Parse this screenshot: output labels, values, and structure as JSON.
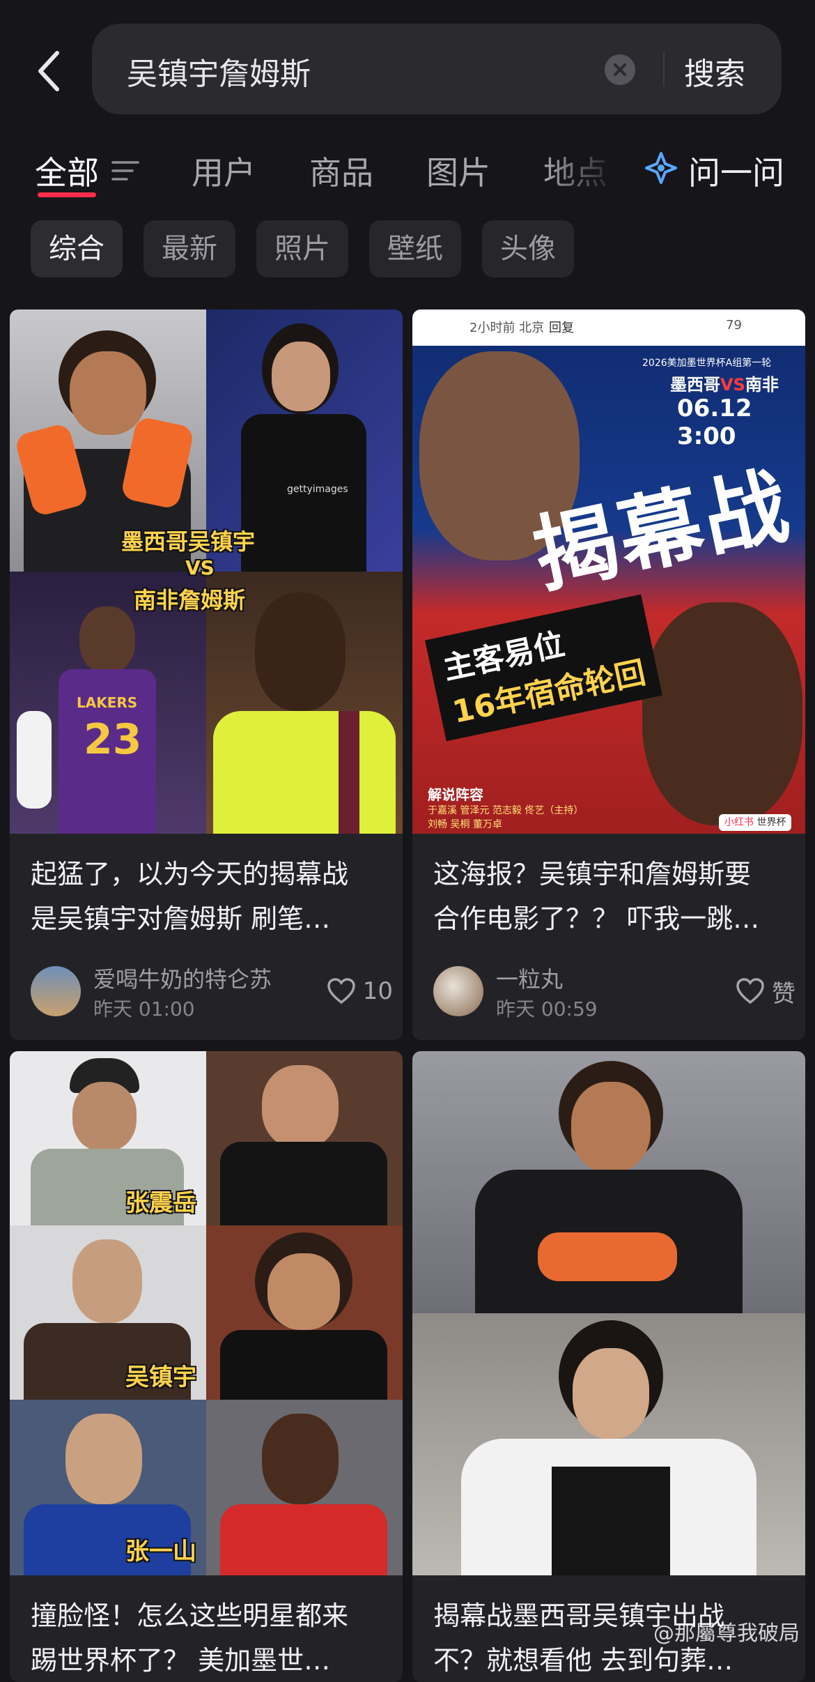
{
  "search": {
    "query": "吴镇宇詹姆斯",
    "button_label": "搜索"
  },
  "tabs": [
    {
      "label": "全部"
    },
    {
      "label": "用户"
    },
    {
      "label": "商品"
    },
    {
      "label": "图片"
    },
    {
      "label": "地点"
    }
  ],
  "ask": {
    "label": "问一问"
  },
  "chips": [
    {
      "label": "综合"
    },
    {
      "label": "最新"
    },
    {
      "label": "照片"
    },
    {
      "label": "壁纸"
    },
    {
      "label": "头像"
    }
  ],
  "cards": [
    {
      "title_line1": "起猛了，以为今天的揭幕战",
      "title_line2": "是吴镇宇对詹姆斯 刷笔…",
      "author": "爱喝牛奶的特仑苏",
      "time": "昨天 01:00",
      "likes": "10",
      "image_text": {
        "caption1": "墨西哥吴镇宇",
        "vs": "VS",
        "caption2": "南非詹姆斯",
        "jersey_number": "23",
        "jersey_team": "LAKERS",
        "getty": "gettyimages"
      }
    },
    {
      "title_line1": "这海报？吴镇宇和詹姆斯要",
      "title_line2": "合作电影了？？ 吓我一跳…",
      "author": "一粒丸",
      "time": "昨天 00:59",
      "likes": "赞",
      "image_text": {
        "top_meta": "2小时前 北京",
        "reply": "回复",
        "heart_count": "79",
        "match_title": "2026美加墨世界杯A组第一轮",
        "teams_left": "墨西哥",
        "teams_vs": "VS",
        "teams_right": "南非",
        "match_time": "06.12 3:00",
        "big_text": "揭幕战",
        "slogan1": "主客易位",
        "slogan2": "16年宿命轮回",
        "commentary_label": "解说阵容",
        "commentators1": "于嘉溪  管泽元  范志毅  佟艺（主持）",
        "commentators2": "刘畅  吴桐  董万卓",
        "tag_app": "小红书",
        "tag_topic": "世界杯"
      }
    },
    {
      "title_line1": "撞脸怪！怎么这些明星都来",
      "title_line2": "踢世界杯了？ 美加墨世…",
      "image_text": {
        "cap1": "张震岳",
        "cap2": "吴镇宇",
        "cap3": "张一山"
      }
    },
    {
      "title_line1": "揭幕战墨西哥吴镇宇出战",
      "title_line2": "不？就想看他 去到句葬…"
    }
  ],
  "watermark": "@那屬尊我破局",
  "colors": {
    "accent": "#ff2d4b",
    "background": "#16161a",
    "card": "#232327",
    "caption_yellow": "#ffd34d"
  }
}
